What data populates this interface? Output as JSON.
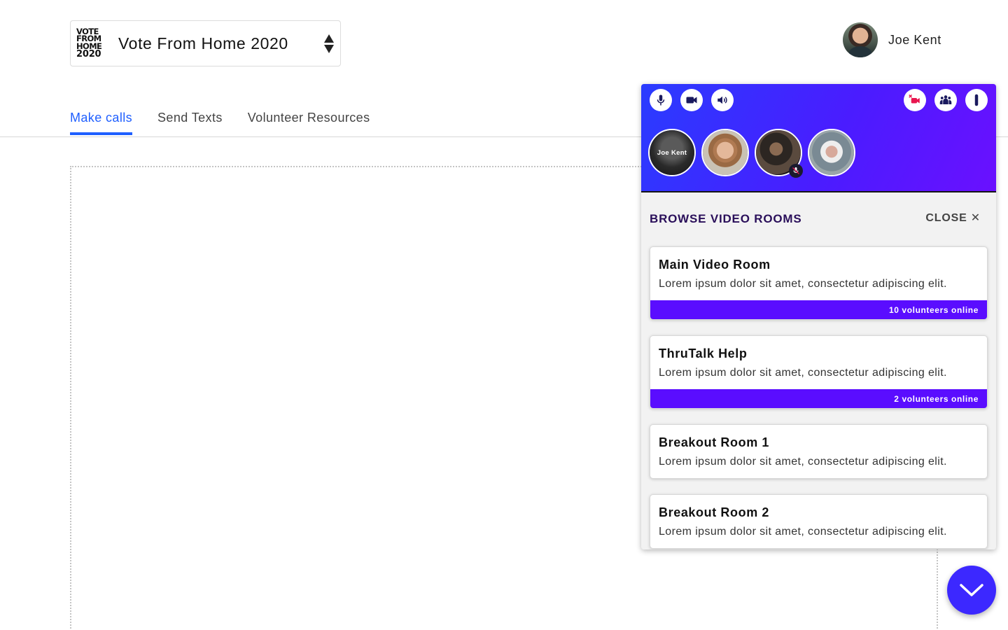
{
  "org": {
    "logo_lines": [
      "VOTE",
      "FROM",
      "HOME",
      "2020"
    ],
    "name": "Vote From Home 2020"
  },
  "user": {
    "name": "Joe Kent"
  },
  "tabs": [
    {
      "label": "Make calls",
      "active": true
    },
    {
      "label": "Send Texts",
      "active": false
    },
    {
      "label": "Volunteer Resources",
      "active": false
    }
  ],
  "video_panel": {
    "controls_left": [
      "microphone-icon",
      "video-camera-icon",
      "speaker-icon"
    ],
    "controls_right": [
      "video-off-icon",
      "group-icon",
      "more-options-icon"
    ],
    "participants": [
      {
        "label": "Joe Kent",
        "muted": false
      },
      {
        "label": "",
        "muted": false
      },
      {
        "label": "",
        "muted": true
      },
      {
        "label": "",
        "muted": false
      }
    ],
    "title": "BROWSE VIDEO ROOMS",
    "close_label": "CLOSE ✕",
    "rooms": [
      {
        "name": "Main Video Room",
        "description": "Lorem ipsum dolor sit amet, consectetur adipiscing elit.",
        "online": "10 volunteers online"
      },
      {
        "name": "ThruTalk Help",
        "description": "Lorem ipsum dolor sit amet, consectetur adipiscing elit.",
        "online": "2 volunteers online"
      },
      {
        "name": "Breakout Room 1",
        "description": "Lorem ipsum dolor sit amet, consectetur adipiscing elit."
      },
      {
        "name": "Breakout Room 2",
        "description": "Lorem ipsum dolor sit amet, consectetur adipiscing elit."
      }
    ]
  },
  "colors": {
    "accent": "#1f5fff",
    "panel_gradient_start": "#2a3cff",
    "panel_gradient_end": "#6a10ff",
    "room_bar": "#5a0dff",
    "fab": "#3c28ff"
  }
}
